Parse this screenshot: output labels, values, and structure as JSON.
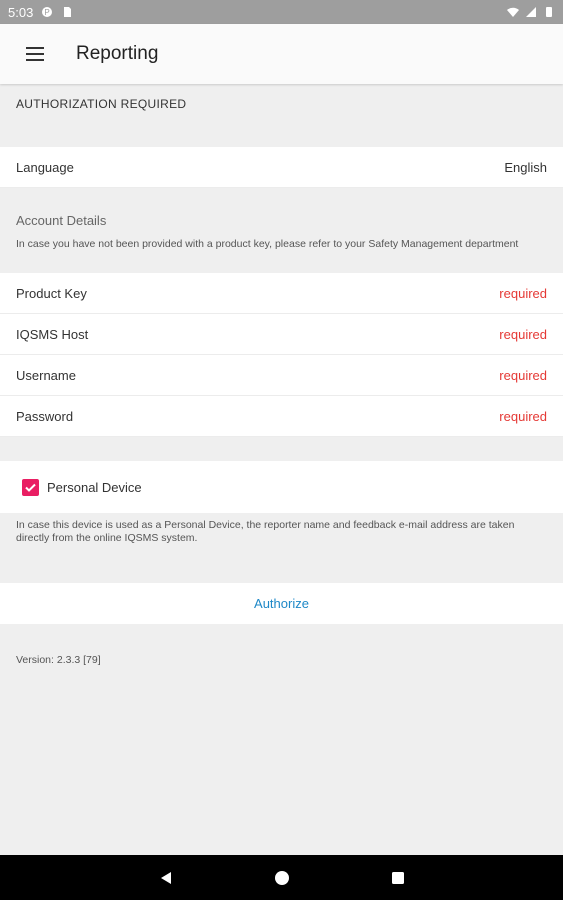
{
  "statusbar": {
    "time": "5:03"
  },
  "appbar": {
    "title": "Reporting"
  },
  "auth": {
    "header": "AUTHORIZATION REQUIRED"
  },
  "language": {
    "label": "Language",
    "value": "English"
  },
  "account": {
    "title": "Account Details",
    "note": "In case you have not been provided with a product key, please refer to your Safety Management department",
    "fields": [
      {
        "label": "Product Key",
        "status": "required"
      },
      {
        "label": "IQSMS Host",
        "status": "required"
      },
      {
        "label": "Username",
        "status": "required"
      },
      {
        "label": "Password",
        "status": "required"
      }
    ]
  },
  "personal_device": {
    "label": "Personal Device",
    "checked": true,
    "note": "In case this device is used as a Personal Device, the reporter name and feedback e-mail address are taken directly from the online IQSMS system."
  },
  "authorize": {
    "label": "Authorize"
  },
  "version": {
    "text": "Version: 2.3.3 [79]"
  },
  "colors": {
    "accent": "#e91e63",
    "required": "#e53935",
    "link": "#1e88c7"
  }
}
